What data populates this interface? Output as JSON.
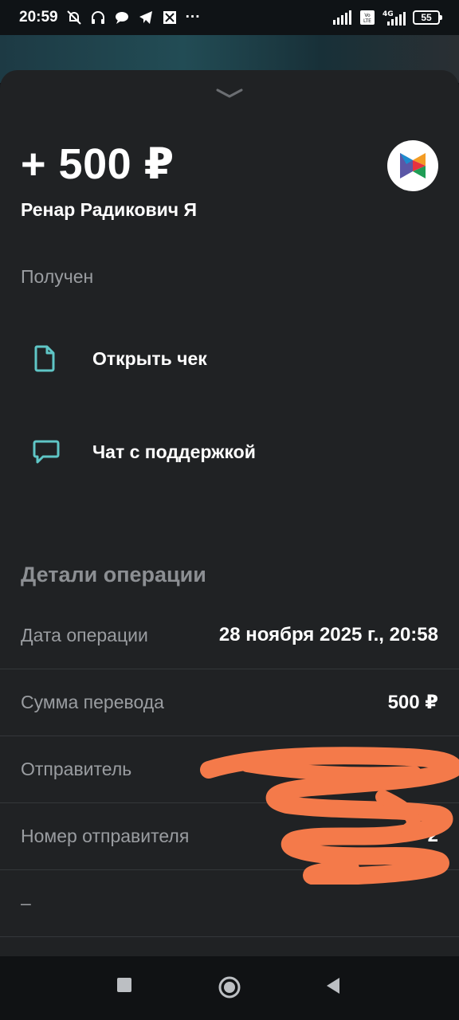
{
  "status_bar": {
    "time": "20:59",
    "battery": "55",
    "network": "4G",
    "volte": "Vo LTE",
    "more": "···"
  },
  "sheet": {
    "amount": "+ 500 ₽",
    "sender_name": "Ренар Радикович Я",
    "status": "Получен",
    "bank_logo": "sbp-logo-icon",
    "actions": [
      {
        "label": "Открыть чек",
        "icon": "receipt-document-icon"
      },
      {
        "label": "Чат с поддержкой",
        "icon": "chat-bubble-icon"
      }
    ]
  },
  "details": {
    "title": "Детали операции",
    "rows": [
      {
        "label": "Дата операции",
        "value": "28 ноября 2025 г., 20:58"
      },
      {
        "label": "Сумма перевода",
        "value": "500 ₽"
      },
      {
        "label": "Отправитель",
        "value": ""
      },
      {
        "label": "Номер отправителя",
        "value": "2"
      },
      {
        "label": "–",
        "value": ""
      }
    ]
  },
  "colors": {
    "sheet_bg": "#202224",
    "accent_teal": "#5fc6c6",
    "redaction_orange": "#f47a4a"
  },
  "nav_bar": {
    "buttons": [
      "recent-apps-icon",
      "home-icon",
      "back-icon"
    ]
  }
}
